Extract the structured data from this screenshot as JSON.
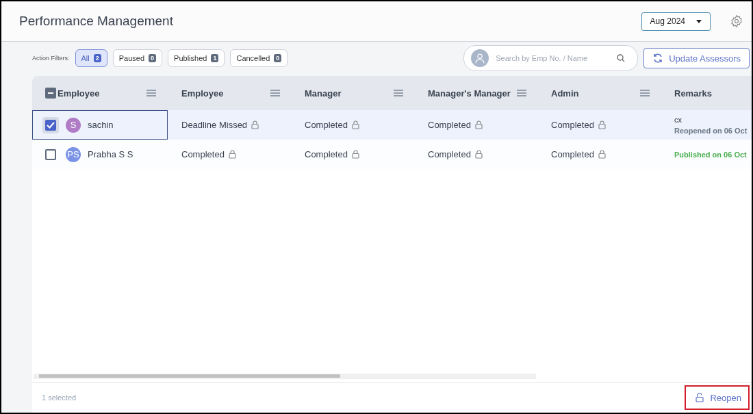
{
  "header": {
    "title": "Performance Management",
    "period": "Aug 2024"
  },
  "filters": {
    "label": "Action Filters:",
    "items": [
      {
        "label": "All",
        "count": "2",
        "selected": true
      },
      {
        "label": "Paused",
        "count": "0",
        "selected": false
      },
      {
        "label": "Published",
        "count": "1",
        "selected": false
      },
      {
        "label": "Cancelled",
        "count": "0",
        "selected": false
      }
    ]
  },
  "search": {
    "placeholder": "Search by Emp No. / Name"
  },
  "update_button": "Update Assessors",
  "table": {
    "select_all": {
      "checked": true,
      "indeterminate": true
    },
    "columns": [
      {
        "label": "Employee",
        "menu": true
      },
      {
        "label": "Employee",
        "menu": true
      },
      {
        "label": "Manager",
        "menu": true
      },
      {
        "label": "Manager's Manager",
        "menu": true
      },
      {
        "label": "Admin",
        "menu": true
      },
      {
        "label": "Remarks",
        "menu": false
      }
    ],
    "rows": [
      {
        "selected": true,
        "initials": "S",
        "color": "#b07cc6",
        "name": "sachin",
        "statuses": [
          "Deadline Missed",
          "Completed",
          "Completed",
          "Completed"
        ],
        "remark_note": "cx",
        "remark": {
          "kind": "reopened",
          "text": "Reopened on 06 Oct"
        }
      },
      {
        "selected": false,
        "initials": "PS",
        "color": "#7b93e6",
        "name": "Prabha S S",
        "statuses": [
          "Completed",
          "Completed",
          "Completed",
          "Completed"
        ],
        "remark": {
          "kind": "published",
          "text": "Published on 06 Oct"
        }
      }
    ]
  },
  "footer": {
    "selection": "1 selected",
    "action": "Reopen"
  }
}
